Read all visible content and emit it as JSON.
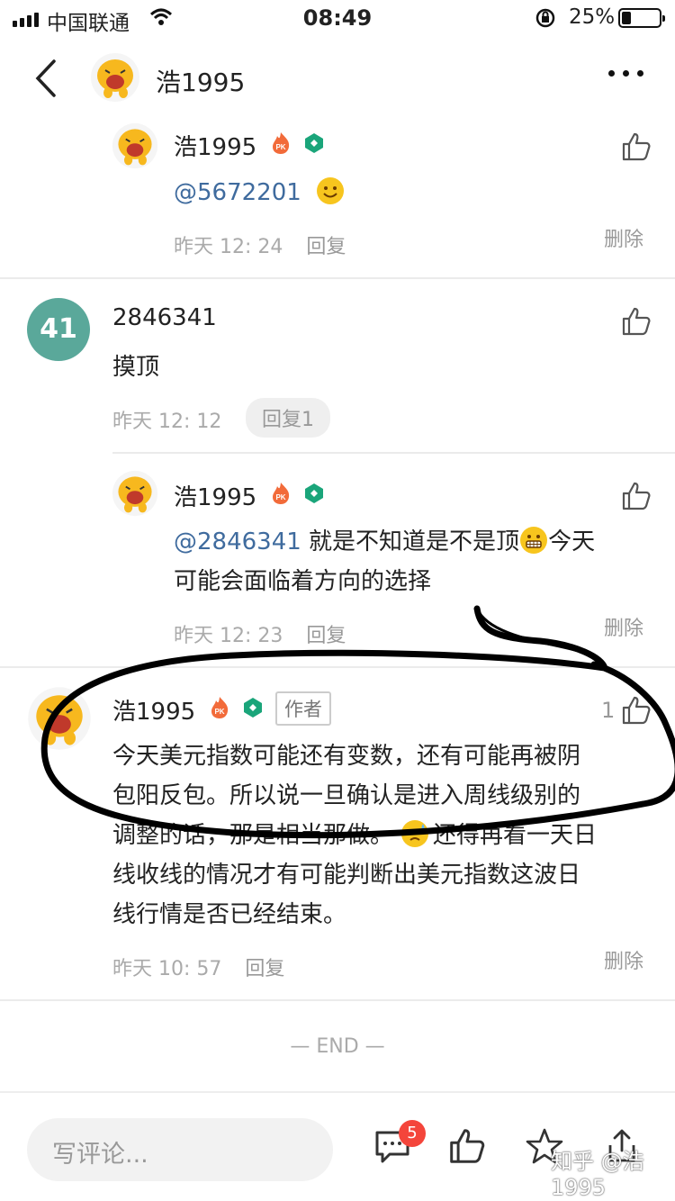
{
  "status_bar": {
    "carrier": "中国联通",
    "time": "08:49",
    "battery": "25%"
  },
  "nav": {
    "title": "浩1995"
  },
  "comments": [
    {
      "name": "浩1995",
      "mention": "@5672201",
      "text": "",
      "time": "昨天 12: 24",
      "reply": "回复",
      "delete": "删除"
    },
    {
      "name": "2846341",
      "avatar_text": "41",
      "text": "摸顶",
      "time": "昨天 12: 12",
      "reply": "回复1"
    },
    {
      "name": "浩1995",
      "mention": "@2846341",
      "text_line1": " 就是不知道是不是顶",
      "text_line1b": "今天",
      "text_line2": "可能会面临着方向的选择",
      "time": "昨天 12: 23",
      "reply": "回复",
      "delete": "删除"
    },
    {
      "name": "浩1995",
      "author_tag": "作者",
      "likes": "1",
      "lines": [
        "今天美元指数可能还有变数，还有可能再被阴",
        "包阳反包。所以说一旦确认是进入周线级别的",
        "调整的话，那是相当那做。",
        "还得再看一天日",
        "线收线的情况才有可能判断出美元指数这波日",
        "线行情是否已经结束。"
      ],
      "time": "昨天 10: 57",
      "reply": "回复",
      "delete": "删除"
    }
  ],
  "end_text": "— END —",
  "bottom": {
    "placeholder": "写评论...",
    "comment_count": "5",
    "watermark": "知乎 @浩1995"
  }
}
